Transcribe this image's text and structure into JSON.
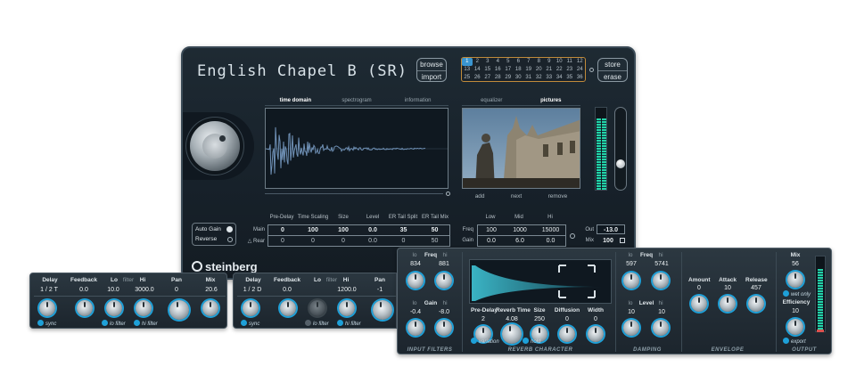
{
  "main": {
    "preset_name": "English Chapel B (SR)",
    "browse": "browse",
    "import": "import",
    "store": "store",
    "erase": "erase",
    "program_numbers": [
      "1",
      "2",
      "3",
      "4",
      "5",
      "6",
      "7",
      "8",
      "9",
      "10",
      "11",
      "12",
      "13",
      "14",
      "15",
      "16",
      "17",
      "18",
      "19",
      "20",
      "21",
      "22",
      "23",
      "24",
      "25",
      "26",
      "27",
      "28",
      "29",
      "30",
      "31",
      "32",
      "33",
      "34",
      "35",
      "36"
    ],
    "selected_program": "1",
    "left_tabs": [
      "time domain",
      "spectrogram",
      "information"
    ],
    "right_tabs": [
      "equalizer",
      "pictures"
    ],
    "picture_buttons": [
      "add",
      "next",
      "remove"
    ],
    "options": {
      "auto_gain": "Auto Gain",
      "reverse": "Reverse"
    },
    "param_headers": [
      "Pre-Delay",
      "Time Scaling",
      "Size",
      "Level",
      "ER Tail Split",
      "ER Tail Mix"
    ],
    "row_main_label": "Main",
    "row_rear_label": "Rear",
    "main_values": [
      "0",
      "100",
      "100",
      "0.0",
      "35",
      "50"
    ],
    "rear_values": [
      "0",
      "0",
      "0",
      "0.0",
      "0",
      "50"
    ],
    "eq_headers": [
      "Low",
      "Mid",
      "Hi"
    ],
    "eq_freq_label": "Freq",
    "eq_gain_label": "Gain",
    "eq_freq": [
      "100",
      "1000",
      "15000"
    ],
    "eq_gain": [
      "0.0",
      "6.0",
      "0.0"
    ],
    "out_label": "Out",
    "out_value": "-13.0",
    "mix_label": "Mix",
    "mix_value": "100",
    "brand": "steinberg"
  },
  "strip1": {
    "headers": [
      "Delay",
      "Feedback",
      "Lo",
      "filter",
      "Hi",
      "Pan",
      "Mix"
    ],
    "values": [
      "1 / 2 T",
      "0.0",
      "10.0",
      "3000.0",
      "0",
      "20.6"
    ],
    "toggles": [
      "sync",
      "lo filter",
      "hi filter"
    ]
  },
  "strip2": {
    "headers": [
      "Delay",
      "Feedback",
      "Lo",
      "filter",
      "Hi",
      "Pan"
    ],
    "values": [
      "1 / 2 D",
      "0.0",
      "1200.0",
      "-1"
    ],
    "toggles": [
      "sync",
      "lo filter",
      "hi filter"
    ]
  },
  "rev2": {
    "input_filters": {
      "lo": "lo",
      "freq": "Freq",
      "hi": "hi",
      "lo_val": "834",
      "hi_val": "881",
      "gain": "Gain",
      "lo_gain": "-0.4",
      "hi_gain": "-8.0"
    },
    "character_labels": [
      "Pre-Delay",
      "Reverb Time",
      "Size",
      "Diffusion",
      "Width"
    ],
    "character_values": [
      "2",
      "4.08",
      "250",
      "0",
      "0"
    ],
    "toggles": [
      "variation",
      "hold"
    ],
    "damping": {
      "lo": "lo",
      "freq": "Freq",
      "hi": "hi",
      "lo_val": "597",
      "hi_val": "5741",
      "level": "Level",
      "lo_level": "10",
      "hi_level": "10"
    },
    "envelope_labels": [
      "Amount",
      "Attack",
      "Release"
    ],
    "envelope_values": [
      "0",
      "10",
      "457"
    ],
    "output": {
      "mix": "Mix",
      "mix_val": "56",
      "wet_only": "wet only",
      "efficiency": "Efficiency",
      "eff_val": "10",
      "export": "export"
    },
    "sections": [
      "INPUT FILTERS",
      "REVERB CHARACTER",
      "DAMPING",
      "ENVELOPE",
      "OUTPUT"
    ]
  }
}
